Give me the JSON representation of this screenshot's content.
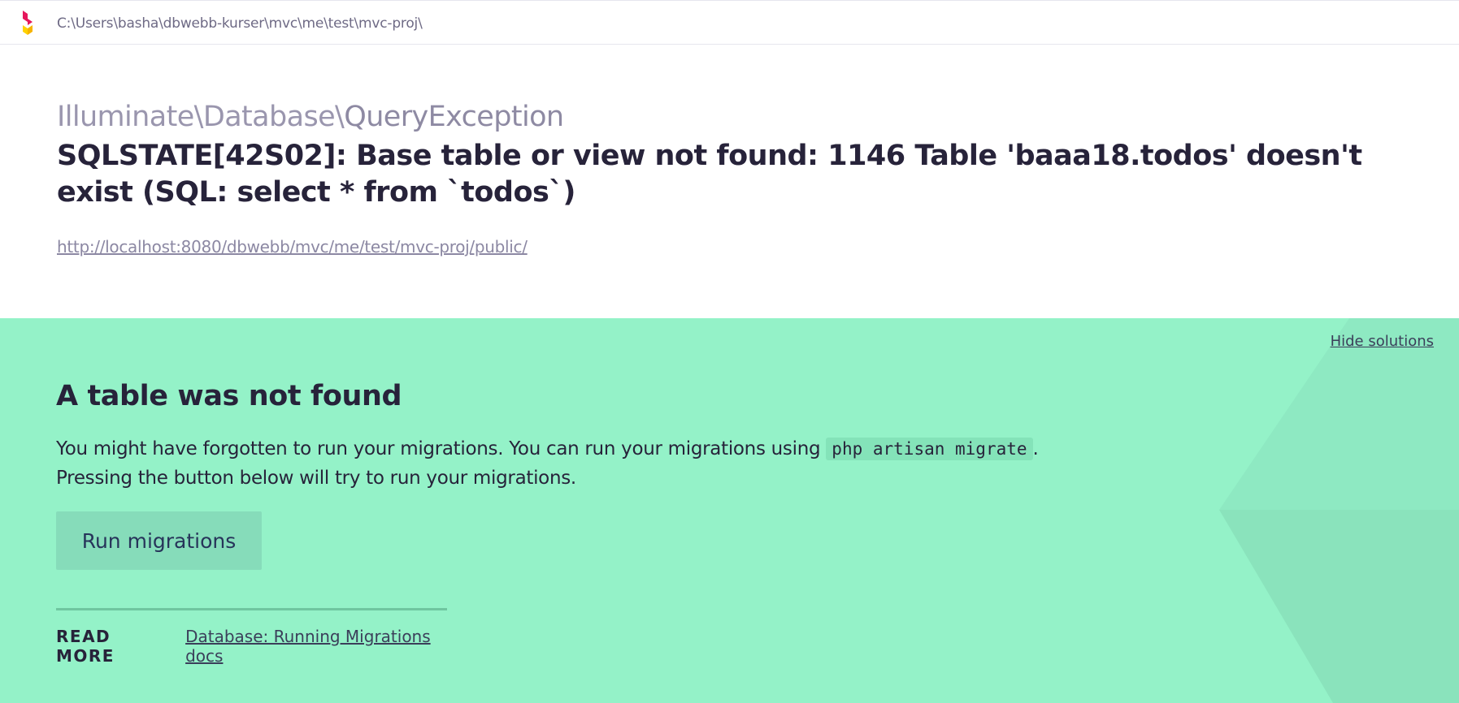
{
  "header": {
    "path": "C:\\Users\\basha\\dbwebb-kurser\\mvc\\me\\test\\mvc-proj\\"
  },
  "error": {
    "exception_namespace": "Illuminate\\Database\\",
    "exception_class": "QueryException",
    "message": "SQLSTATE[42S02]: Base table or view not found: 1146 Table 'baaa18.todos' doesn't exist (SQL: select * from `todos`)",
    "url": "http://localhost:8080/dbwebb/mvc/me/test/mvc-proj/public/"
  },
  "solution": {
    "hide_label": "Hide solutions",
    "title": "A table was not found",
    "description_before": "You might have forgotten to run your migrations. You can run your migrations using ",
    "command": "php artisan migrate",
    "description_after": ".",
    "description_line2": "Pressing the button below will try to run your migrations.",
    "button_label": "Run migrations",
    "read_more_label": "READ MORE",
    "docs_link": "Database: Running Migrations docs"
  },
  "colors": {
    "solution_bg": "#94f2c8",
    "brand_pink": "#e6175c",
    "brand_yellow": "#ffd200"
  }
}
